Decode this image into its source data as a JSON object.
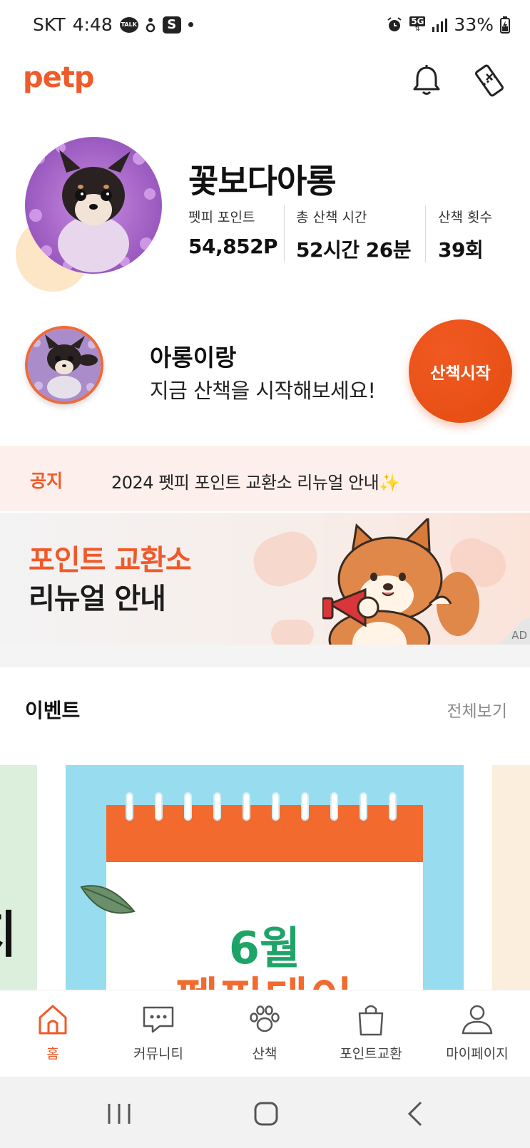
{
  "status_bar": {
    "carrier": "SKT",
    "time": "4:48",
    "talk_badge": "TALK",
    "s_badge": "S",
    "network": "5G",
    "battery": "33%"
  },
  "header": {
    "logo": "petp"
  },
  "profile": {
    "pet_name": "꽃보다아롱",
    "stats": [
      {
        "label": "펫피 포인트",
        "value": "54,852P"
      },
      {
        "label": "총 산책 시간",
        "value": "52시간 26분"
      },
      {
        "label": "산책 횟수",
        "value": "39회"
      }
    ]
  },
  "walk": {
    "title": "아롱이랑",
    "message": "지금 산책을 시작해보세요!",
    "start_label": "산책시작"
  },
  "notice": {
    "tag": "공지",
    "text": "2024 펫피 포인트 교환소 리뉴얼 안내✨"
  },
  "banner": {
    "line1": "포인트 교환소",
    "line2": "리뉴얼 안내",
    "ad_label": "AD"
  },
  "events": {
    "title": "이벤트",
    "see_all": "전체보기",
    "left_card_text": "지",
    "main_card_month": "6월",
    "main_card_day": "펫피데이"
  },
  "bottom_nav": {
    "items": [
      {
        "label": "홈",
        "icon": "home-icon",
        "active": true
      },
      {
        "label": "커뮤니티",
        "icon": "chat-icon",
        "active": false
      },
      {
        "label": "산책",
        "icon": "paw-icon",
        "active": false
      },
      {
        "label": "포인트교환",
        "icon": "shopping-bag-icon",
        "active": false
      },
      {
        "label": "마이페이지",
        "icon": "user-icon",
        "active": false
      }
    ]
  },
  "colors": {
    "accent": "#ef5a2a",
    "notice_bg": "#fdf0ec",
    "event_green": "#1fa468",
    "calendar_blue": "#98dcef"
  }
}
